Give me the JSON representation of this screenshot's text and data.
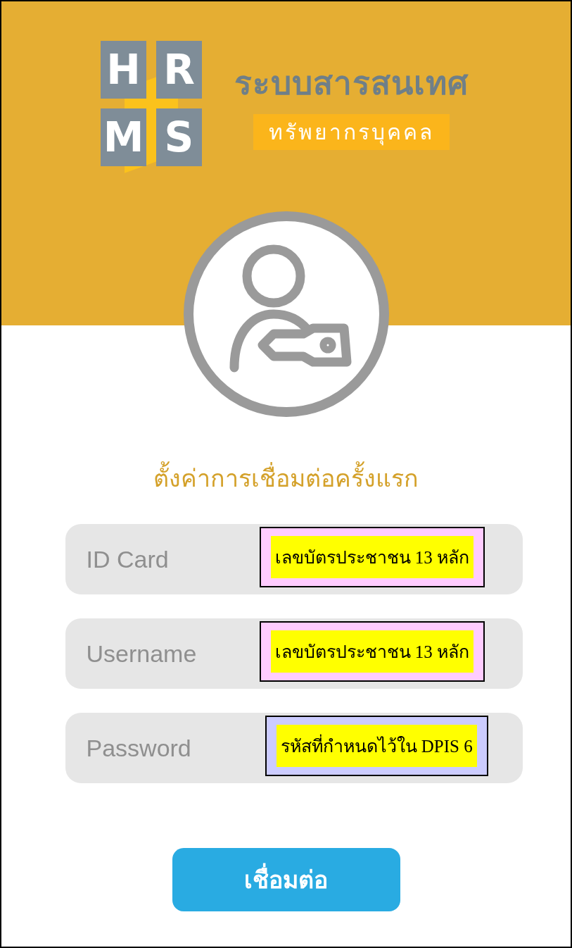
{
  "logo": {
    "letters": [
      "H",
      "R",
      "M",
      "S"
    ],
    "title": "ระบบสารสนเทศ",
    "subtitle": "ทรัพยากรบุคคล"
  },
  "heading": "ตั้งค่าการเชื่อมต่อครั้งแรก",
  "fields": [
    {
      "placeholder": "ID Card",
      "kind": "text",
      "note": {
        "text": "เลขบัตรประชาชน 13 หลัก",
        "color": "#ffccff"
      }
    },
    {
      "placeholder": "Username",
      "kind": "text",
      "note": {
        "text": "เลขบัตรประชาชน 13 หลัก",
        "color": "#ffccff"
      }
    },
    {
      "placeholder": "Password",
      "kind": "password",
      "note": {
        "text": "รหัสที่กำหนดไว้ใน DPIS 6",
        "color": "#ccccff"
      }
    }
  ],
  "button": "เชื่อมต่อ"
}
